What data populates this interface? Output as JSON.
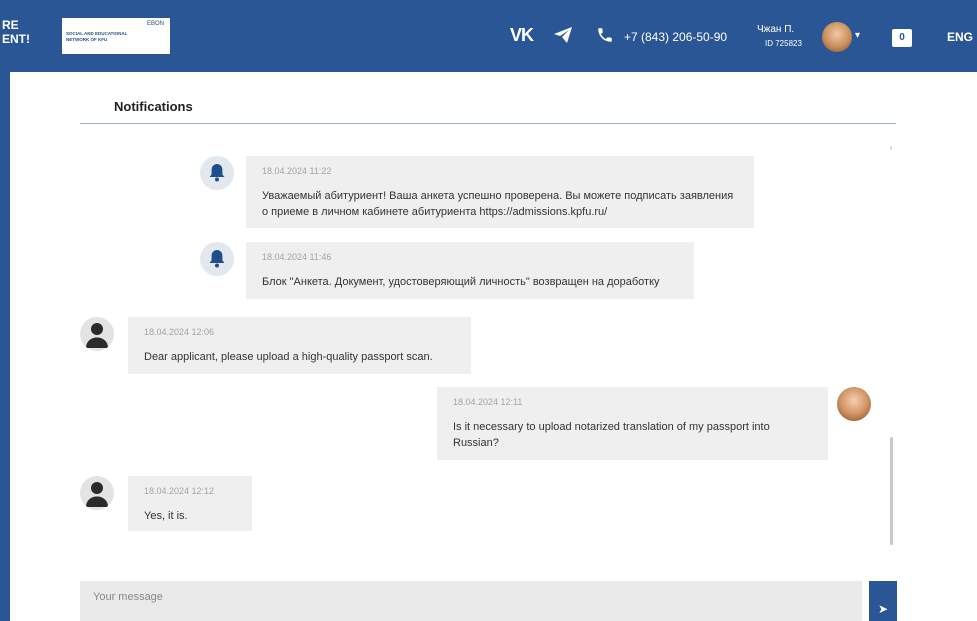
{
  "header": {
    "brand_partial": "RE\nENT!",
    "logo_mark": "EBON",
    "logo_text": "SOCIAL AND EDUCATIONAL\nNETWORK OF KFU",
    "phone": "+7 (843) 206-50-90",
    "user_name": "Чжан П.",
    "user_id": "ID 725823",
    "messages_count": "0",
    "language": "ENG",
    "icons": [
      "vk-icon",
      "telegram-icon",
      "phone-icon",
      "user-avatar",
      "chevron-down-icon",
      "message-icon"
    ]
  },
  "page": {
    "title": "Notifications"
  },
  "messages": [
    {
      "sender": "system",
      "time": "18.04.2024 11:22",
      "text": "Уважаемый абитуриент! Ваша анкета успешно проверена. Вы можете подписать заявления о приеме в личном кабинете абитуриента https://admissions.kpfu.ru/"
    },
    {
      "sender": "system",
      "time": "18.04.2024 11:46",
      "text": "Блок \"Анкета. Документ, удостоверяющий личность\" возвращен на доработку"
    },
    {
      "sender": "staff",
      "time": "18.04.2024 12:06",
      "text": "Dear applicant, please upload a high-quality passport scan."
    },
    {
      "sender": "user",
      "time": "18.04.2024 12:11",
      "text": "Is it necessary to upload notarized translation of my passport into Russian?"
    },
    {
      "sender": "staff",
      "time": "18.04.2024 12:12",
      "text": "Yes, it is."
    }
  ],
  "composer": {
    "placeholder": "Your message",
    "value": ""
  },
  "colors": {
    "primary": "#2b5695",
    "bubble": "#efefef",
    "text": "#333333",
    "timestamp": "#a3a3a3"
  }
}
